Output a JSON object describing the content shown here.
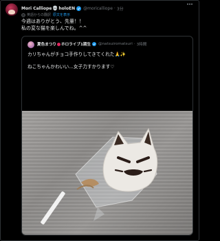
{
  "tweet": {
    "author_name": "Mori Calliope",
    "author_name_suffix": "holoEN",
    "skull_icon": "💀",
    "handle": "@moricalliope",
    "time": "3分",
    "translated_from": "英語からの翻訳",
    "show_original": "原文を表示",
    "lines": [
      "今週はありがとう、先輩！！",
      "私の変な猫を楽しんでね。^^"
    ]
  },
  "quote": {
    "author_name": "夏色まつり",
    "author_name_suffix": "ホロライブ1期生",
    "handle": "@natsuiromatsuri",
    "time": "3時間",
    "line1": "カリちゃんがチョコ手作りしてきてくれた🙏✨",
    "line2": "ねこちゃんかわいい…女子力すかります♡"
  },
  "colors": {
    "background": "#000000",
    "text": "#e7e9ea",
    "muted": "#71767b",
    "accent": "#1d9bf0"
  }
}
